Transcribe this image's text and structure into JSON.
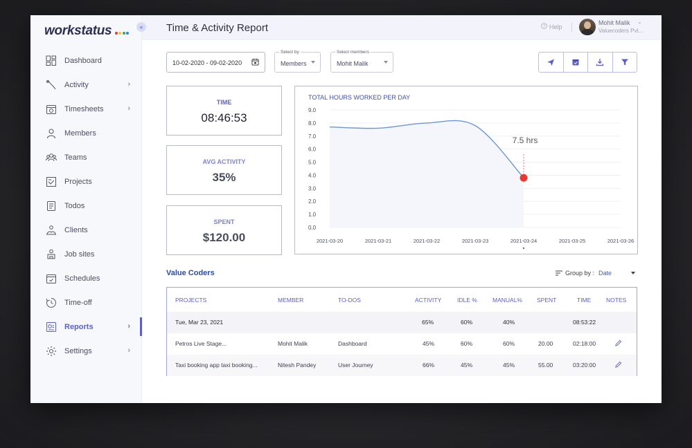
{
  "app": {
    "logo": "workstatus",
    "logo_dot_colors": [
      "#e53935",
      "#fbc02d",
      "#43a047",
      "#1e88e5"
    ]
  },
  "colors": {
    "accent": "#5b5fc7",
    "chart_line": "#6a96d8",
    "marker": "#e53935"
  },
  "header": {
    "title": "Time & Activity Report",
    "help": "Help",
    "user_name": "Mohit Malik",
    "user_company": "Valuecoders Pvt..."
  },
  "sidebar": {
    "items": [
      {
        "label": "Dashboard",
        "icon": "dashboard-icon",
        "chevron": false,
        "active": false
      },
      {
        "label": "Activity",
        "icon": "activity-icon",
        "chevron": true,
        "active": false
      },
      {
        "label": "Timesheets",
        "icon": "timesheets-icon",
        "chevron": true,
        "active": false
      },
      {
        "label": "Members",
        "icon": "member-icon",
        "chevron": false,
        "active": false
      },
      {
        "label": "Teams",
        "icon": "teams-icon",
        "chevron": false,
        "active": false
      },
      {
        "label": "Projects",
        "icon": "projects-icon",
        "chevron": false,
        "active": false
      },
      {
        "label": "Todos",
        "icon": "todos-icon",
        "chevron": false,
        "active": false
      },
      {
        "label": "Clients",
        "icon": "clients-icon",
        "chevron": false,
        "active": false
      },
      {
        "label": "Job sites",
        "icon": "job-sites-icon",
        "chevron": false,
        "active": false
      },
      {
        "label": "Schedules",
        "icon": "schedules-icon",
        "chevron": false,
        "active": false
      },
      {
        "label": "Time-off",
        "icon": "time-off-icon",
        "chevron": false,
        "active": false
      },
      {
        "label": "Reports",
        "icon": "reports-icon",
        "chevron": true,
        "active": true
      },
      {
        "label": "Settings",
        "icon": "settings-icon",
        "chevron": true,
        "active": false
      }
    ]
  },
  "filters": {
    "date_range": "10-02-2020 - 09-02-2020",
    "select_by_label": "Select by",
    "select_by_value": "Members",
    "members_label": "Select members",
    "members_value": "Mohit Malik"
  },
  "actions": [
    "send-icon",
    "calendar-icon",
    "download-icon",
    "filter-icon"
  ],
  "stats": {
    "time": {
      "label": "TIME",
      "value": "08:46:53"
    },
    "activity": {
      "label": "AVG ACTIVITY",
      "value": "35%"
    },
    "spent": {
      "label": "SPENT",
      "value": "$120.00"
    }
  },
  "chart_data": {
    "type": "line",
    "title": "TOTAL HOURS WORKED PER DAY",
    "x": [
      "2021-03-20",
      "2021-03-21",
      "2021-03-22",
      "2021-03-23",
      "2021-03-24",
      "2021-03-25",
      "2021-03-26"
    ],
    "y_ticks": [
      "0.0",
      "1.0",
      "2.0",
      "3.0",
      "4.0",
      "5.0",
      "6.0",
      "7.0",
      "8.0",
      "9.0"
    ],
    "ylim": [
      0,
      9
    ],
    "series": [
      {
        "values": [
          7.7,
          7.6,
          8.0,
          7.8,
          3.8,
          null,
          null
        ]
      }
    ],
    "highlight": {
      "index": 4,
      "label": "7.5 hrs"
    },
    "grid": true
  },
  "section": {
    "title": "Value Coders",
    "group_by_label": "Group by :",
    "group_by_value": "Date"
  },
  "table": {
    "columns": [
      "PROJECTS",
      "MEMBER",
      "TO-DOS",
      "ACTIVITY",
      "IDLE %",
      "MANUAL%",
      "SPENT",
      "TIME",
      "NOTES"
    ],
    "group": {
      "date": "Tue, Mar 23, 2021",
      "activity": "65%",
      "idle": "60%",
      "manual": "40%",
      "time": "08:53:22"
    },
    "rows": [
      {
        "project": "Petros Live Stage...",
        "member": "Mohit Malik",
        "todo": "Dashboard",
        "activity": "45%",
        "idle": "60%",
        "manual": "60%",
        "spent": "20.00",
        "time": "02:18:00"
      },
      {
        "project": "Taxi booking app taxi booking...",
        "member": "Nitesh Pandey",
        "todo": "User Journey",
        "activity": "66%",
        "idle": "45%",
        "manual": "45%",
        "spent": "55.00",
        "time": "03:20:00"
      }
    ]
  }
}
